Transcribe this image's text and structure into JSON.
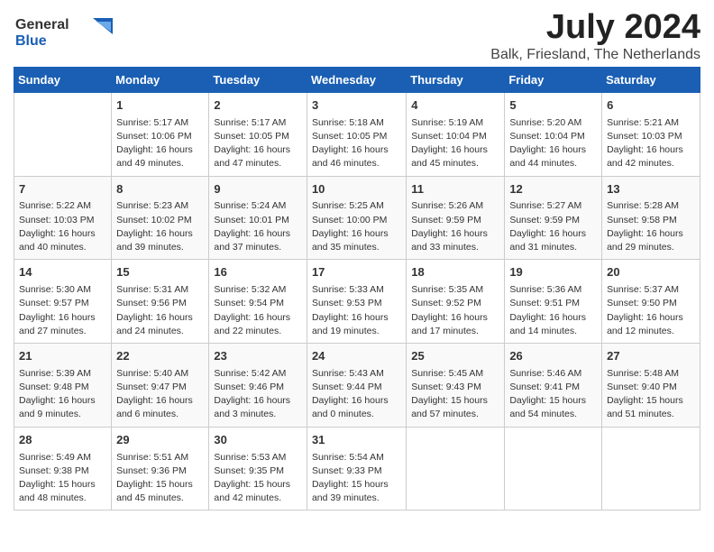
{
  "logo": {
    "general": "General",
    "blue": "Blue"
  },
  "title": "July 2024",
  "location": "Balk, Friesland, The Netherlands",
  "days_of_week": [
    "Sunday",
    "Monday",
    "Tuesday",
    "Wednesday",
    "Thursday",
    "Friday",
    "Saturday"
  ],
  "weeks": [
    [
      {
        "day": "",
        "content": ""
      },
      {
        "day": "1",
        "content": "Sunrise: 5:17 AM\nSunset: 10:06 PM\nDaylight: 16 hours\nand 49 minutes."
      },
      {
        "day": "2",
        "content": "Sunrise: 5:17 AM\nSunset: 10:05 PM\nDaylight: 16 hours\nand 47 minutes."
      },
      {
        "day": "3",
        "content": "Sunrise: 5:18 AM\nSunset: 10:05 PM\nDaylight: 16 hours\nand 46 minutes."
      },
      {
        "day": "4",
        "content": "Sunrise: 5:19 AM\nSunset: 10:04 PM\nDaylight: 16 hours\nand 45 minutes."
      },
      {
        "day": "5",
        "content": "Sunrise: 5:20 AM\nSunset: 10:04 PM\nDaylight: 16 hours\nand 44 minutes."
      },
      {
        "day": "6",
        "content": "Sunrise: 5:21 AM\nSunset: 10:03 PM\nDaylight: 16 hours\nand 42 minutes."
      }
    ],
    [
      {
        "day": "7",
        "content": "Sunrise: 5:22 AM\nSunset: 10:03 PM\nDaylight: 16 hours\nand 40 minutes."
      },
      {
        "day": "8",
        "content": "Sunrise: 5:23 AM\nSunset: 10:02 PM\nDaylight: 16 hours\nand 39 minutes."
      },
      {
        "day": "9",
        "content": "Sunrise: 5:24 AM\nSunset: 10:01 PM\nDaylight: 16 hours\nand 37 minutes."
      },
      {
        "day": "10",
        "content": "Sunrise: 5:25 AM\nSunset: 10:00 PM\nDaylight: 16 hours\nand 35 minutes."
      },
      {
        "day": "11",
        "content": "Sunrise: 5:26 AM\nSunset: 9:59 PM\nDaylight: 16 hours\nand 33 minutes."
      },
      {
        "day": "12",
        "content": "Sunrise: 5:27 AM\nSunset: 9:59 PM\nDaylight: 16 hours\nand 31 minutes."
      },
      {
        "day": "13",
        "content": "Sunrise: 5:28 AM\nSunset: 9:58 PM\nDaylight: 16 hours\nand 29 minutes."
      }
    ],
    [
      {
        "day": "14",
        "content": "Sunrise: 5:30 AM\nSunset: 9:57 PM\nDaylight: 16 hours\nand 27 minutes."
      },
      {
        "day": "15",
        "content": "Sunrise: 5:31 AM\nSunset: 9:56 PM\nDaylight: 16 hours\nand 24 minutes."
      },
      {
        "day": "16",
        "content": "Sunrise: 5:32 AM\nSunset: 9:54 PM\nDaylight: 16 hours\nand 22 minutes."
      },
      {
        "day": "17",
        "content": "Sunrise: 5:33 AM\nSunset: 9:53 PM\nDaylight: 16 hours\nand 19 minutes."
      },
      {
        "day": "18",
        "content": "Sunrise: 5:35 AM\nSunset: 9:52 PM\nDaylight: 16 hours\nand 17 minutes."
      },
      {
        "day": "19",
        "content": "Sunrise: 5:36 AM\nSunset: 9:51 PM\nDaylight: 16 hours\nand 14 minutes."
      },
      {
        "day": "20",
        "content": "Sunrise: 5:37 AM\nSunset: 9:50 PM\nDaylight: 16 hours\nand 12 minutes."
      }
    ],
    [
      {
        "day": "21",
        "content": "Sunrise: 5:39 AM\nSunset: 9:48 PM\nDaylight: 16 hours\nand 9 minutes."
      },
      {
        "day": "22",
        "content": "Sunrise: 5:40 AM\nSunset: 9:47 PM\nDaylight: 16 hours\nand 6 minutes."
      },
      {
        "day": "23",
        "content": "Sunrise: 5:42 AM\nSunset: 9:46 PM\nDaylight: 16 hours\nand 3 minutes."
      },
      {
        "day": "24",
        "content": "Sunrise: 5:43 AM\nSunset: 9:44 PM\nDaylight: 16 hours\nand 0 minutes."
      },
      {
        "day": "25",
        "content": "Sunrise: 5:45 AM\nSunset: 9:43 PM\nDaylight: 15 hours\nand 57 minutes."
      },
      {
        "day": "26",
        "content": "Sunrise: 5:46 AM\nSunset: 9:41 PM\nDaylight: 15 hours\nand 54 minutes."
      },
      {
        "day": "27",
        "content": "Sunrise: 5:48 AM\nSunset: 9:40 PM\nDaylight: 15 hours\nand 51 minutes."
      }
    ],
    [
      {
        "day": "28",
        "content": "Sunrise: 5:49 AM\nSunset: 9:38 PM\nDaylight: 15 hours\nand 48 minutes."
      },
      {
        "day": "29",
        "content": "Sunrise: 5:51 AM\nSunset: 9:36 PM\nDaylight: 15 hours\nand 45 minutes."
      },
      {
        "day": "30",
        "content": "Sunrise: 5:53 AM\nSunset: 9:35 PM\nDaylight: 15 hours\nand 42 minutes."
      },
      {
        "day": "31",
        "content": "Sunrise: 5:54 AM\nSunset: 9:33 PM\nDaylight: 15 hours\nand 39 minutes."
      },
      {
        "day": "",
        "content": ""
      },
      {
        "day": "",
        "content": ""
      },
      {
        "day": "",
        "content": ""
      }
    ]
  ]
}
